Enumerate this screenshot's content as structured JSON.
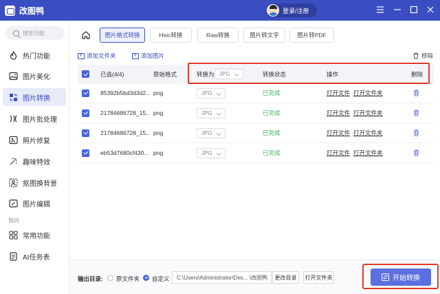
{
  "app": {
    "title": "改图鸭",
    "login": "登录/注册"
  },
  "colors": {
    "brand": "#3a4ec2",
    "accent": "#5b6fe0",
    "done": "#3cb45a",
    "highlight": "#e03a2a"
  },
  "sidebar": {
    "search_placeholder": "搜索功能",
    "items": [
      {
        "label": "热门功能",
        "icon": "fire-icon"
      },
      {
        "label": "图片美化",
        "icon": "image-icon"
      },
      {
        "label": "图片转换",
        "icon": "convert-icon",
        "active": true
      },
      {
        "label": "图片批处理",
        "icon": "batch-icon"
      },
      {
        "label": "照片修复",
        "icon": "repair-icon"
      },
      {
        "label": "趣味特效",
        "icon": "effects-icon"
      },
      {
        "label": "抠图换背景",
        "icon": "cutout-icon"
      },
      {
        "label": "图片编辑",
        "icon": "edit-icon"
      }
    ],
    "section_label": "我的",
    "my_items": [
      {
        "label": "常用功能",
        "icon": "grid-icon"
      },
      {
        "label": "AI任务表",
        "icon": "ai-task-icon"
      }
    ]
  },
  "tabs": [
    "图片格式转换",
    "Heic转换",
    "Raw转换",
    "图片转文字",
    "图片转PDF"
  ],
  "toolbar": {
    "add_folder": "添加文件夹",
    "add_image": "添加图片",
    "remove": "移除"
  },
  "table": {
    "headers": {
      "selected": "已选(4/4)",
      "format": "原始格式",
      "convert_to": "转换为",
      "target_format": "JPG",
      "status": "转换状态",
      "actions": "操作",
      "delete": "删除"
    },
    "rows": [
      {
        "name": "85392b5bd3d3d2...",
        "format": "png",
        "target": "JPG",
        "status": "已完成",
        "open_file": "打开文件",
        "open_folder": "打开文件夹"
      },
      {
        "name": "21784686728_15...",
        "format": "png",
        "target": "JPG",
        "status": "已完成",
        "open_file": "打开文件",
        "open_folder": "打开文件夹"
      },
      {
        "name": "21784686728_15...",
        "format": "png",
        "target": "JPG",
        "status": "已完成",
        "open_file": "打开文件",
        "open_folder": "打开文件夹"
      },
      {
        "name": "eb53d7680cf430...",
        "format": "png",
        "target": "JPG",
        "status": "已完成",
        "open_file": "打开文件",
        "open_folder": "打开文件夹"
      }
    ]
  },
  "output": {
    "label": "输出目录:",
    "option_original": "原文件夹",
    "option_custom": "自定义",
    "path": "C:\\Users\\Administrator\\Des... \\改图鸭",
    "change_dir": "更改目录",
    "open_folder": "打开文件夹",
    "start": "开始转换"
  }
}
